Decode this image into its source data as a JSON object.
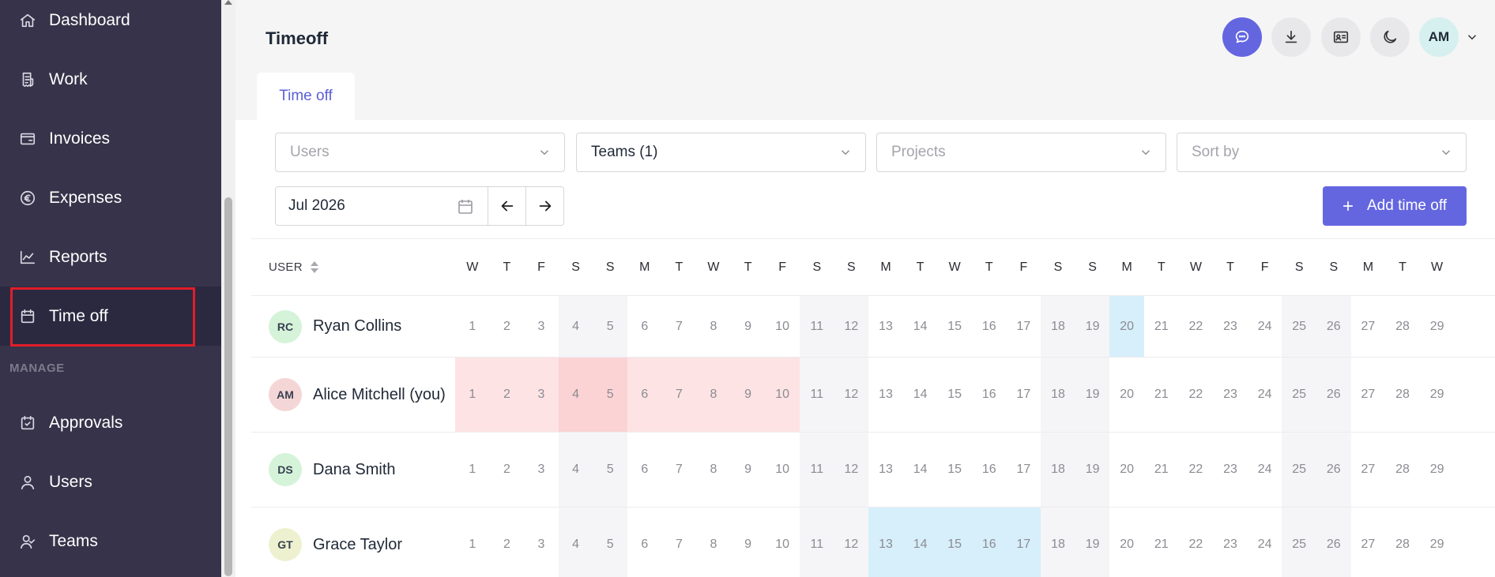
{
  "sidebar": {
    "items": [
      {
        "label": "Dashboard",
        "icon": "home-icon"
      },
      {
        "label": "Work",
        "icon": "receipt-icon"
      },
      {
        "label": "Invoices",
        "icon": "wallet-icon"
      },
      {
        "label": "Expenses",
        "icon": "euro-icon"
      },
      {
        "label": "Reports",
        "icon": "chart-icon"
      },
      {
        "label": "Time off",
        "icon": "calendar-icon",
        "active": true
      }
    ],
    "manage_label": "MANAGE",
    "manage_items": [
      {
        "label": "Approvals",
        "icon": "calendar-check-icon"
      },
      {
        "label": "Users",
        "icon": "user-icon"
      },
      {
        "label": "Teams",
        "icon": "team-icon"
      }
    ]
  },
  "header": {
    "title": "Timeoff",
    "avatar_initials": "AM",
    "tab_label": "Time off"
  },
  "filters": {
    "users_placeholder": "Users",
    "teams_value": "Teams (1)",
    "projects_placeholder": "Projects",
    "sort_placeholder": "Sort by",
    "month_value": "Jul 2026",
    "add_button_label": "Add time off"
  },
  "calendar": {
    "user_header": "USER",
    "weekdays": [
      "W",
      "T",
      "F",
      "S",
      "S",
      "M",
      "T",
      "W",
      "T",
      "F",
      "S",
      "S",
      "M",
      "T",
      "W",
      "T",
      "F",
      "S",
      "S",
      "M",
      "T",
      "W",
      "T",
      "F",
      "S",
      "S",
      "M",
      "T",
      "W"
    ],
    "days": [
      "1",
      "2",
      "3",
      "4",
      "5",
      "6",
      "7",
      "8",
      "9",
      "10",
      "11",
      "12",
      "13",
      "14",
      "15",
      "16",
      "17",
      "18",
      "19",
      "20",
      "21",
      "22",
      "23",
      "24",
      "25",
      "26",
      "27",
      "28",
      "29"
    ],
    "users": [
      {
        "initials": "RC",
        "name": "Ryan Collins",
        "avatar_color": "#d5f3d9",
        "time_off_days": [
          20
        ],
        "time_off_type": "blue"
      },
      {
        "initials": "AM",
        "name": "Alice Mitchell (you)",
        "avatar_color": "#f5d6d6",
        "time_off_days": [
          1,
          2,
          3,
          4,
          5,
          6,
          7,
          8,
          9,
          10
        ],
        "time_off_type": "red"
      },
      {
        "initials": "DS",
        "name": "Dana Smith",
        "avatar_color": "#d5f3d9",
        "time_off_days": [],
        "time_off_type": "none"
      },
      {
        "initials": "GT",
        "name": "Grace Taylor",
        "avatar_color": "#eef1cf",
        "time_off_days": [
          13,
          14,
          15,
          16,
          17
        ],
        "time_off_type": "blue"
      }
    ]
  },
  "colors": {
    "accent": "#6466e0",
    "sidebar_bg": "#36334a",
    "pto_red": "#fde3e4",
    "pto_blue": "#d7effa"
  }
}
